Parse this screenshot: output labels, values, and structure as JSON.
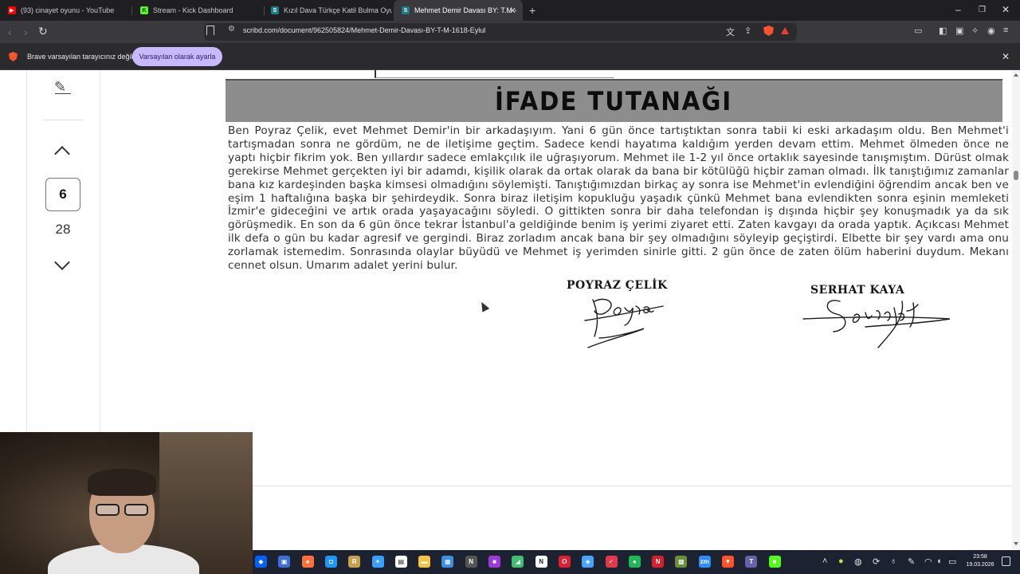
{
  "browser": {
    "tabs": [
      {
        "label": "(93) cinayet oyunu - YouTube",
        "favicon": "youtube-icon",
        "color": "#ff0000",
        "active": false
      },
      {
        "label": "Stream - Kick Dashboard",
        "favicon": "kick-icon",
        "color": "#53fc18",
        "active": false
      },
      {
        "label": "Kızıl Dava Türkçe Katil Bulma Oyunu",
        "favicon": "scribd-icon",
        "color": "#1e7b85",
        "active": false
      },
      {
        "label": "Mehmet Demir Davası BY: T.M -",
        "favicon": "scribd-icon",
        "color": "#1e7b85",
        "active": true
      }
    ],
    "new_tab": "+",
    "window_controls": {
      "minimize": "–",
      "maximize": "❐",
      "close": "✕"
    },
    "url": "scribd.com/document/962505824/Mehmet-Demir-Davası-BY-T-M-1618-Eylul",
    "infobar": {
      "text": "Brave varsayılan tarayıcınız değil",
      "button": "Varsayılan olarak ayarla",
      "close": "✕"
    }
  },
  "viewer": {
    "current_page": "6",
    "total_pages": "28"
  },
  "document": {
    "heading": "İFADE TUTANAĞI",
    "body": "Ben Poyraz Çelik, evet Mehmet Demir'in bir arkadaşıyım. Yani 6 gün önce tartıştıktan sonra tabii ki eski arkadaşım oldu. Ben Mehmet'i tartışmadan sonra ne gördüm, ne de iletişime geçtim. Sadece kendi hayatıma kaldığım yerden devam ettim. Mehmet ölmeden önce ne yaptı hiçbir fikrim yok. Ben yıllardır sadece emlakçılık ile uğraşıyorum. Mehmet ile 1-2 yıl önce ortaklık sayesinde tanışmıştım. Dürüst olmak gerekirse Mehmet gerçekten iyi bir adamdı, kişilik olarak da ortak olarak da bana bir kötülüğü hiçbir zaman olmadı. İlk tanıştığımız zamanlar bana kız kardeşinden başka kimsesi olmadığını söylemişti. Tanıştığımızdan birkaç ay sonra ise Mehmet'in evlendiğini öğrendim ancak ben ve eşim 1 haftalığına başka bir şehirdeydik. Sonra biraz iletişim kopukluğu yaşadık çünkü Mehmet bana evlendikten sonra eşinin memleketi İzmir'e gideceğini ve artık orada yaşayacağını söyledi. O gittikten sonra bir daha telefondan iş dışında hiçbir şey konuşmadık ya da sık görüşmedik. En son da 6 gün önce tekrar İstanbul'a geldiğinde benim iş yerimi ziyaret etti. Zaten kavgayı da orada yaptık. Açıkcası Mehmet ilk defa o gün bu kadar agresif ve gergindi. Biraz zorladım ancak bana bir şey olmadığını söyleyip geçiştirdi. Elbette bir şey vardı ama onu zorlamak istemedim. Sonrasında olaylar büyüdü ve Mehmet iş yerimden sinirle gitti. 2 gün önce de zaten ölüm haberini duydum. Mekanı cennet olsun. Umarım adalet yerini bulur.",
    "signatures": [
      {
        "name": "POYRAZ ÇELİK",
        "signature_text": "Poyraz"
      },
      {
        "name": "SERHAT KAYA",
        "signature_text": "Serhat"
      }
    ]
  },
  "taskbar": {
    "time": "23:58",
    "date": "19.03.2026",
    "apps": [
      {
        "icon": "dropbox-icon",
        "color": "#0061fe",
        "glyph": "◆"
      },
      {
        "icon": "window-icon",
        "color": "#3d6fd8",
        "glyph": "▣"
      },
      {
        "icon": "firefox-icon",
        "color": "#ff7139",
        "glyph": "●"
      },
      {
        "icon": "files-icon",
        "color": "#2196f3",
        "glyph": "◘"
      },
      {
        "icon": "game-icon",
        "color": "#c8a24a",
        "glyph": "R"
      },
      {
        "icon": "copilot-icon",
        "color": "#3aa0ff",
        "glyph": "✦"
      },
      {
        "icon": "document-icon",
        "color": "#ffffff",
        "glyph": "▤"
      },
      {
        "icon": "folder-icon",
        "color": "#f4c542",
        "glyph": "▬"
      },
      {
        "icon": "store-icon",
        "color": "#3a8ee6",
        "glyph": "▦"
      },
      {
        "icon": "notion-n-icon",
        "color": "#555555",
        "glyph": "N"
      },
      {
        "icon": "purple-app-icon",
        "color": "#9b3ad8",
        "glyph": "■"
      },
      {
        "icon": "bluestacks-icon",
        "color": "#3fbf6f",
        "glyph": "◢"
      },
      {
        "icon": "notion-icon",
        "color": "#ffffff",
        "glyph": "N"
      },
      {
        "icon": "opera-icon",
        "color": "#e0202e",
        "glyph": "O"
      },
      {
        "icon": "shield-app-icon",
        "color": "#4aa3ff",
        "glyph": "◈"
      },
      {
        "icon": "capcut-icon",
        "color": "#e23a4a",
        "glyph": "✓"
      },
      {
        "icon": "spotify-icon",
        "color": "#1db954",
        "glyph": "●"
      },
      {
        "icon": "red-app-icon",
        "color": "#d8202a",
        "glyph": "N"
      },
      {
        "icon": "minecraft-icon",
        "color": "#6b8e3a",
        "glyph": "▩"
      },
      {
        "icon": "zoom-icon",
        "color": "#2d8cff",
        "glyph": "zm"
      },
      {
        "icon": "brave-icon",
        "color": "#fb542b",
        "glyph": "▼"
      },
      {
        "icon": "teams-icon",
        "color": "#6264a7",
        "glyph": "T"
      },
      {
        "icon": "kick-app-icon",
        "color": "#53fc18",
        "glyph": "■"
      }
    ]
  }
}
